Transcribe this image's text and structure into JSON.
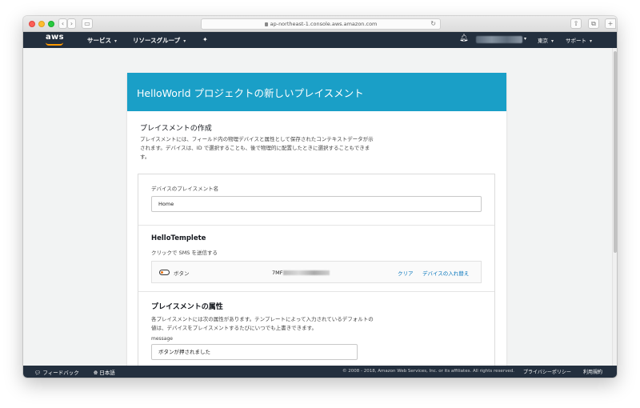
{
  "browser": {
    "url": "ap-northeast-1.console.aws.amazon.com"
  },
  "awsnav": {
    "logo": "aws",
    "services": "サービス",
    "resource_groups": "リソースグループ",
    "region": "東京",
    "support": "サポート"
  },
  "panel": {
    "title": "HelloWorld プロジェクトの新しいプレイスメント",
    "section_title": "プレイスメントの作成",
    "section_desc": "プレイスメントには、フィールド内の物理デバイスと属性として保存されたコンテキストデータが示されます。デバイスは、ID で選択することも、後で物理的に配置したときに選択することもできます。",
    "name_label": "デバイスのプレイスメント名",
    "name_value": "Home",
    "template_title": "HelloTemplete",
    "template_desc": "クリックで SMS を送信する",
    "device_label": "ボタン",
    "device_serial_prefix": "7MF",
    "clear_link": "クリア",
    "replace_link": "デバイスの入れ替え",
    "attr_title": "プレイスメントの属性",
    "attr_desc": "各プレイスメントには次の属性があります。テンプレートによって入力されているデフォルトの値は、デバイスをプレイスメントするたびにいつでも上書きできます。",
    "message_label": "message",
    "message_value": "ボタンが押されました"
  },
  "footer": {
    "feedback": "フィードバック",
    "language": "日本語",
    "copyright": "© 2008 - 2018, Amazon Web Services, Inc. or its affiliates. All rights reserved.",
    "privacy": "プライバシーポリシー",
    "terms": "利用規約"
  },
  "colors": {
    "aws_nav": "#232f3e",
    "panel_header": "#1a9fc7",
    "link": "#0073bb",
    "aws_orange": "#ff9900"
  }
}
